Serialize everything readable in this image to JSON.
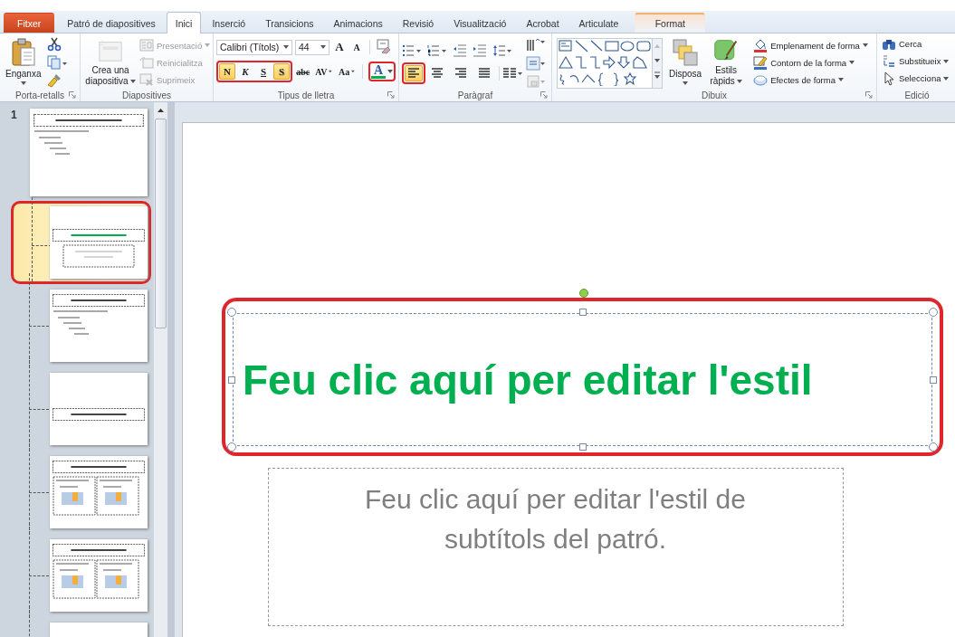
{
  "tabs": [
    {
      "label": "Fitxer",
      "kind": "file",
      "selected": false
    },
    {
      "label": "Patró de diapositives",
      "kind": "normal",
      "selected": false
    },
    {
      "label": "Inici",
      "kind": "normal",
      "selected": true
    },
    {
      "label": "Inserció",
      "kind": "normal",
      "selected": false
    },
    {
      "label": "Transicions",
      "kind": "normal",
      "selected": false
    },
    {
      "label": "Animacions",
      "kind": "normal",
      "selected": false
    },
    {
      "label": "Revisió",
      "kind": "normal",
      "selected": false
    },
    {
      "label": "Visualització",
      "kind": "normal",
      "selected": false
    },
    {
      "label": "Acrobat",
      "kind": "normal",
      "selected": false
    },
    {
      "label": "Articulate",
      "kind": "normal",
      "selected": false
    },
    {
      "label": "Format",
      "kind": "contextual",
      "selected": false
    }
  ],
  "clipboard": {
    "label": "Porta-retalls",
    "paste": "Enganxa"
  },
  "slides_group": {
    "label": "Diapositives",
    "new_slide": "Crea una diapositiva",
    "commands": [
      {
        "label": "Presentació",
        "kind": "layout",
        "disabled": true,
        "dropdown": true
      },
      {
        "label": "Reinicialitza",
        "kind": "reset",
        "disabled": true,
        "dropdown": false
      },
      {
        "label": "Suprimeix",
        "kind": "delete",
        "disabled": true,
        "dropdown": false
      }
    ]
  },
  "font": {
    "label": "Tipus de lletra",
    "name": "Calibri (Títols)",
    "size": "44",
    "grow": "A",
    "shrink": "A",
    "styles_highlighted": true,
    "styles": [
      {
        "label": "N",
        "kind": "bold",
        "on": true
      },
      {
        "label": "K",
        "kind": "italic",
        "on": false
      },
      {
        "label": "S",
        "kind": "underline",
        "on": false
      },
      {
        "label": "S",
        "kind": "shadow",
        "on": true
      }
    ],
    "more": [
      {
        "label": "abc",
        "kind": "strike",
        "dropdown": false
      },
      {
        "label": "AV",
        "kind": "spacing",
        "dropdown": true
      },
      {
        "label": "Aa",
        "kind": "case",
        "dropdown": true
      }
    ],
    "color_button": {
      "label": "A",
      "highlighted": true
    }
  },
  "paragraph": {
    "label": "Paràgraf",
    "align": [
      {
        "kind": "left",
        "selected": true,
        "highlighted": true
      },
      {
        "kind": "center",
        "selected": false,
        "highlighted": false
      },
      {
        "kind": "right",
        "selected": false,
        "highlighted": false
      },
      {
        "kind": "justify",
        "selected": false,
        "highlighted": false
      }
    ]
  },
  "drawing": {
    "label": "Dibuix",
    "arrange": "Disposa",
    "quick_styles": "Estils ràpids",
    "commands": [
      {
        "label": "Emplenament de forma",
        "kind": "fill"
      },
      {
        "label": "Contorn de la forma",
        "kind": "outline"
      },
      {
        "label": "Efectes de forma",
        "kind": "effects"
      }
    ]
  },
  "editing": {
    "label": "Edició",
    "commands": [
      {
        "label": "Cerca",
        "kind": "find",
        "dropdown": false
      },
      {
        "label": "Substitueix",
        "kind": "replace",
        "dropdown": true
      },
      {
        "label": "Selecciona",
        "kind": "select",
        "dropdown": true
      }
    ]
  },
  "thumbnails": [
    {
      "number": "1",
      "kind": "master",
      "selected": false,
      "highlighted": false
    },
    {
      "kind": "title",
      "selected": true,
      "highlighted": true
    },
    {
      "kind": "content",
      "selected": false,
      "highlighted": false
    },
    {
      "kind": "section",
      "selected": false,
      "highlighted": false
    },
    {
      "kind": "two",
      "selected": false,
      "highlighted": false
    },
    {
      "kind": "comparison",
      "selected": false,
      "highlighted": false
    },
    {
      "kind": "cut",
      "selected": false,
      "highlighted": false
    }
  ],
  "slide": {
    "title": "Feu clic aquí per editar l'estil",
    "title_selected": true,
    "title_highlighted": true,
    "subtitle": "Feu clic aquí per editar l'estil de subtítols del patró."
  }
}
